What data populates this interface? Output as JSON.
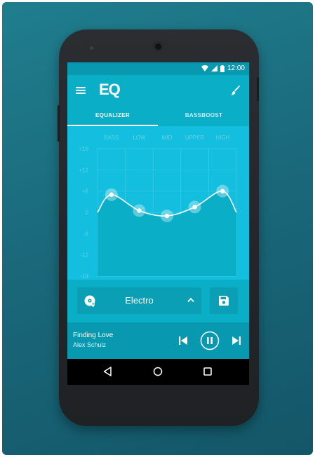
{
  "status_bar": {
    "time": "12:00"
  },
  "app_bar": {
    "logo_text": "EQ"
  },
  "tabs": [
    {
      "label": "EQUALIZER",
      "active": true
    },
    {
      "label": "BASSBOOST",
      "active": false
    }
  ],
  "equalizer": {
    "bands": [
      "BASS",
      "LOW",
      "MID",
      "UPPER",
      "HIGH"
    ],
    "db_scale": [
      "+18",
      "+12",
      "+6",
      "0",
      "-6",
      "-12",
      "-18"
    ],
    "values_db": [
      5,
      0.5,
      -1,
      1.5,
      6
    ],
    "colors": {
      "background": "#14bede",
      "fill": "#0aaec7",
      "curve": "#ffffff"
    }
  },
  "preset": {
    "name": "Electro",
    "icon": "vinyl-music-icon"
  },
  "save_icon": "floppy-disk-icon",
  "player": {
    "title": "Finding Love",
    "artist": "Alex Schulz",
    "icons": [
      "skip-previous-icon",
      "pause-icon",
      "skip-next-icon"
    ]
  },
  "nav_bar": {
    "icons": [
      "back-icon",
      "home-icon",
      "recents-icon"
    ]
  },
  "colors": {
    "accent": "#0aaec7",
    "dark_accent": "#0899b0",
    "backdrop": "#1a6a7c"
  }
}
